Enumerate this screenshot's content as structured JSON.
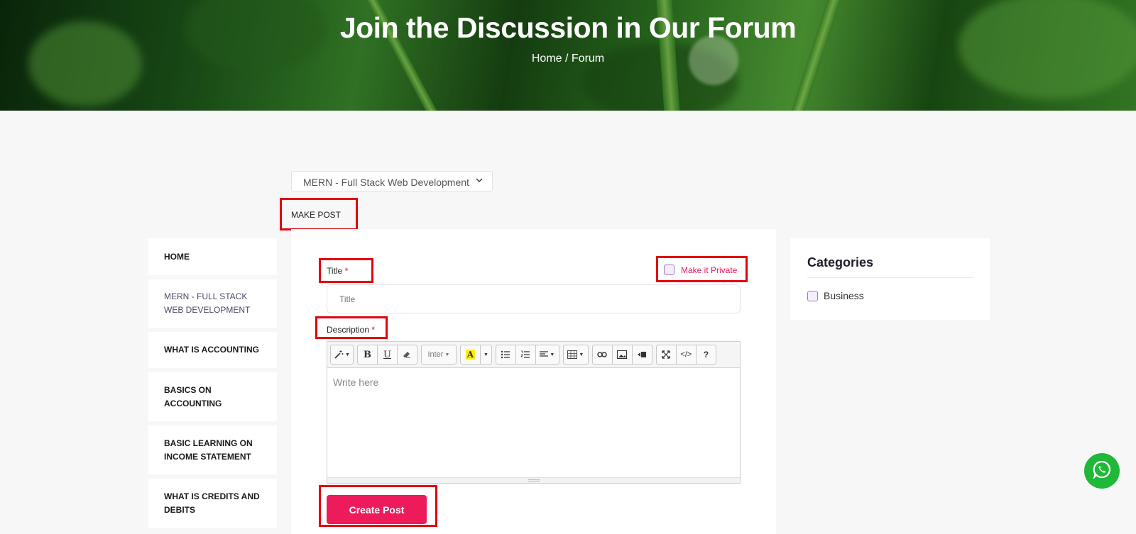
{
  "banner": {
    "title": "Join the Discussion in Our Forum",
    "breadcrumb_home": "Home",
    "breadcrumb_sep": " / ",
    "breadcrumb_current": "Forum"
  },
  "course_select": {
    "value": "MERN - Full Stack Web Development"
  },
  "make_post_label": "MAKE POST",
  "sidebar": {
    "items": [
      {
        "label": "HOME"
      },
      {
        "label": "MERN - FULL STACK WEB DEVELOPMENT"
      },
      {
        "label": "WHAT IS ACCOUNTING"
      },
      {
        "label": "BASICS ON ACCOUNTING"
      },
      {
        "label": "BASIC LEARNING ON INCOME STATEMENT"
      },
      {
        "label": "WHAT IS CREDITS AND DEBITS"
      }
    ]
  },
  "form": {
    "title_label": "Title",
    "required_mark": "*",
    "title_placeholder": "Title",
    "private_label": "Make it Private",
    "description_label": "Description",
    "editor_placeholder": "Write here",
    "font_name": "Inter",
    "submit_label": "Create Post"
  },
  "categories": {
    "title": "Categories",
    "items": [
      {
        "label": "Business"
      }
    ]
  },
  "colors": {
    "accent": "#ED1A5C",
    "highlight": "#E3000F",
    "whatsapp": "#1FB839"
  }
}
